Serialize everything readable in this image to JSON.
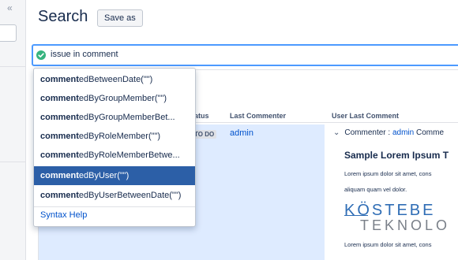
{
  "left_rail": {
    "collapse_glyph": "«"
  },
  "header": {
    "title": "Search",
    "save_as_label": "Save as"
  },
  "query": {
    "text": "issue in comment",
    "status_icon": "check-circle-icon",
    "status_color": "#36b37e"
  },
  "autocomplete": {
    "items": [
      {
        "match": "comment",
        "rest": "edBetweenDate(\"\")"
      },
      {
        "match": "comment",
        "rest": "edByGroupMember(\"\")"
      },
      {
        "match": "comment",
        "rest": "edByGroupMemberBet..."
      },
      {
        "match": "comment",
        "rest": "edByRoleMember(\"\")"
      },
      {
        "match": "comment",
        "rest": "edByRoleMemberBetwe..."
      },
      {
        "match": "comment",
        "rest": "edByUser(\"\")"
      },
      {
        "match": "comment",
        "rest": "edByUserBetweenDate(\"\")"
      }
    ],
    "selected_index": 5,
    "selected_color": "#2c5fa7",
    "syntax_help_label": "Syntax Help"
  },
  "table": {
    "columns": [
      "tatus",
      "Last Commenter",
      "User Last Comment"
    ],
    "row": {
      "status": "TO DO",
      "last_commenter": "admin",
      "comment_chevron": "⌄",
      "comment_label": "Commenter : ",
      "comment_user": "admin",
      "comment_tail": " Comme",
      "sample_title": "Sample Lorem Ipsum T",
      "lorem_line_1": "Lorem ipsum dolor sit amet, cons",
      "lorem_line_2": "aliquam quam vel dolor.",
      "logo_top": "KÖSTEBE",
      "logo_bottom": "TEKNOLO",
      "lorem_line_3": "Lorem ipsum dolor sit amet, cons"
    }
  }
}
